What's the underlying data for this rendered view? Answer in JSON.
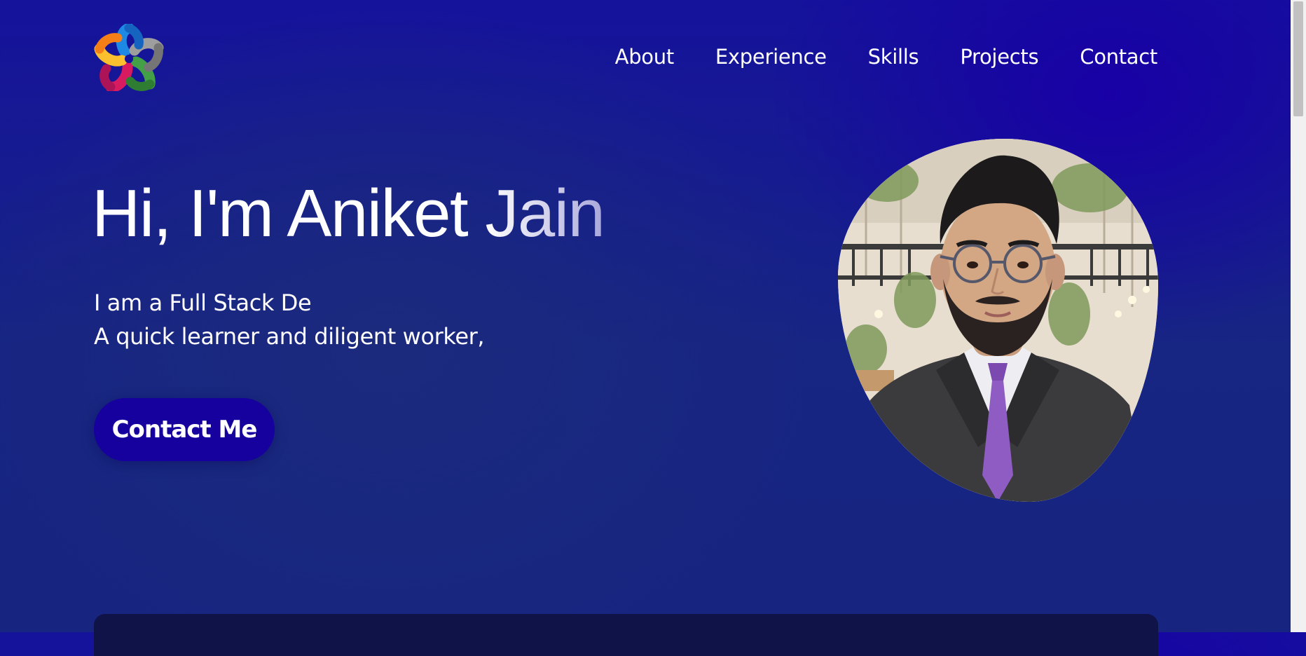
{
  "header": {
    "logo_icon": "colorful-star-hands-logo",
    "nav": [
      {
        "label": "About"
      },
      {
        "label": "Experience"
      },
      {
        "label": "Skills"
      },
      {
        "label": "Projects"
      },
      {
        "label": "Contact"
      }
    ]
  },
  "hero": {
    "title_main": "Hi, I'm Aniket ",
    "title_highlight": "Jain",
    "desc_line1": "I am a Full Stack De",
    "desc_line2": "A quick learner and diligent worker,",
    "cta_label": "Contact Me"
  },
  "colors": {
    "background": "#15129c",
    "accent": "#16009e",
    "text": "#ffffff",
    "card": "#0f1347"
  }
}
